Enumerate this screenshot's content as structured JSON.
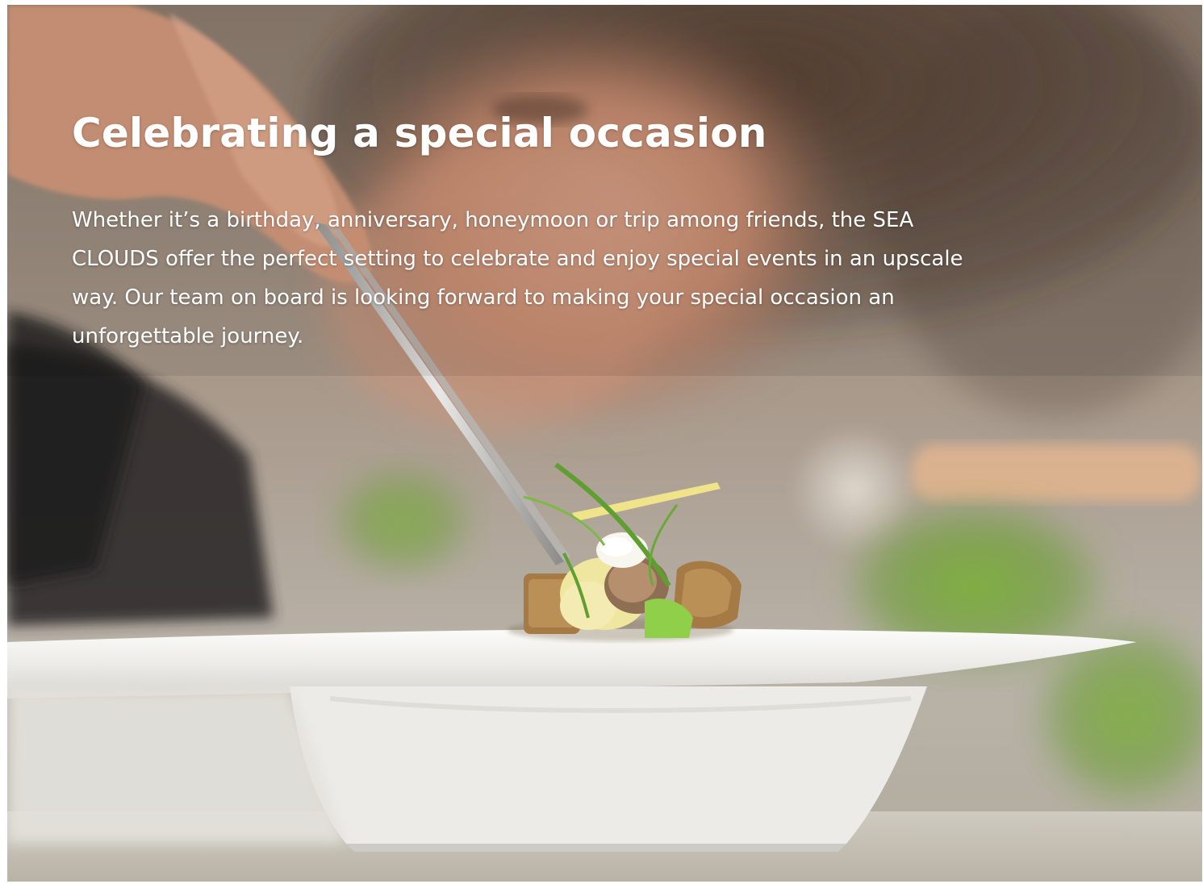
{
  "headline": "Celebrating a special occasion",
  "body": "Whether it’s a birthday, anniversary, honeymoon or trip among friends, the SEA CLOUDS offer the perfect setting to celebrate and enjoy special events in an upscale way. Our team on board is looking forward to making your special occasion an unforgettable journey.",
  "colors": {
    "text": "#ffffff",
    "plate": "#efefed",
    "garnish_green": "#7fae3a"
  }
}
